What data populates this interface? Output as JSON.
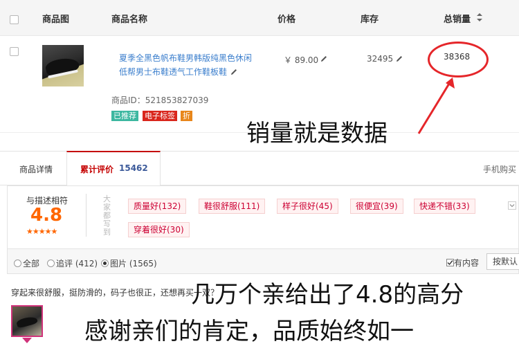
{
  "table": {
    "headers": {
      "image": "商品图",
      "name": "商品名称",
      "price": "价格",
      "stock": "库存",
      "sales": "总销量",
      "sort_icon": "sort-updown-icon"
    },
    "product": {
      "title_line1": "夏季全黑色帆布鞋男韩版纯黑色休闲",
      "title_line2": "低帮男士布鞋透气工作鞋板鞋",
      "price": "￥ 89.00",
      "stock": "32495",
      "sales": "38368",
      "id_label": "商品ID：521853827039",
      "tags": {
        "recommended": "已推荐",
        "red_tag": "电子标签",
        "discount": "折"
      }
    }
  },
  "annotations": {
    "sales_note": "销量就是数据",
    "rating_note": "几万个亲给出了4.8的高分",
    "thanks_note": "感谢亲们的肯定，品质始终如一"
  },
  "reviews": {
    "tabs": {
      "details": "商品详情",
      "reviews_label": "累计评价",
      "reviews_count": "15462",
      "mobile": "手机购买"
    },
    "rating": {
      "label": "与描述相符",
      "score": "4.8",
      "stars": "★★★★★",
      "side_text": "大家都写到"
    },
    "chips": [
      "质量好(132)",
      "鞋很舒服(111)",
      "样子很好(45)",
      "很便宜(39)",
      "快递不错(33)",
      "穿着很好(30)"
    ],
    "filters": {
      "all": "全部",
      "append": "追评 (412)",
      "picture": "图片 (1565)",
      "has_content": "有内容",
      "sort": "按默认"
    },
    "first_review_text": "穿起来很舒服，挺防滑的，码子也很正，还想再买一双？"
  },
  "colors": {
    "link": "#3c7fcd",
    "accent_red": "#c40000",
    "rating_orange": "#f60",
    "annotation_red": "#e5262a"
  }
}
